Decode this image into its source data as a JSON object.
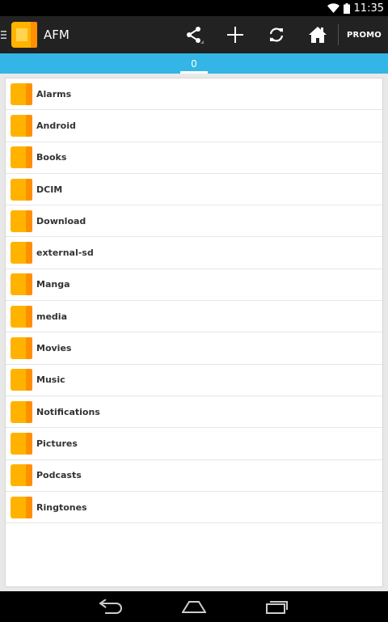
{
  "status_bar": {
    "time": "11:35",
    "icons": [
      "wifi-icon",
      "battery-icon"
    ]
  },
  "action_bar": {
    "title": "AFM",
    "app_icon": "afm-app-icon",
    "actions": [
      "share-icon",
      "add-icon",
      "refresh-icon",
      "home-icon"
    ],
    "promo_label": "PROMO"
  },
  "tabs": {
    "items": [
      {
        "label": "0",
        "selected": true
      }
    ]
  },
  "file_list": {
    "items": [
      {
        "name": "Alarms"
      },
      {
        "name": "Android"
      },
      {
        "name": "Books"
      },
      {
        "name": "DCIM"
      },
      {
        "name": "Download"
      },
      {
        "name": "external-sd"
      },
      {
        "name": "Manga"
      },
      {
        "name": "media"
      },
      {
        "name": "Movies"
      },
      {
        "name": "Music"
      },
      {
        "name": "Notifications"
      },
      {
        "name": "Pictures"
      },
      {
        "name": "Podcasts"
      },
      {
        "name": "Ringtones"
      }
    ]
  },
  "nav_bar": {
    "buttons": [
      "back-icon",
      "home-nav-icon",
      "recents-icon"
    ]
  },
  "colors": {
    "accent": "#33b5e5",
    "action_bar": "#222222",
    "folder": "#ffb300",
    "folder_spine": "#ff8f00"
  }
}
